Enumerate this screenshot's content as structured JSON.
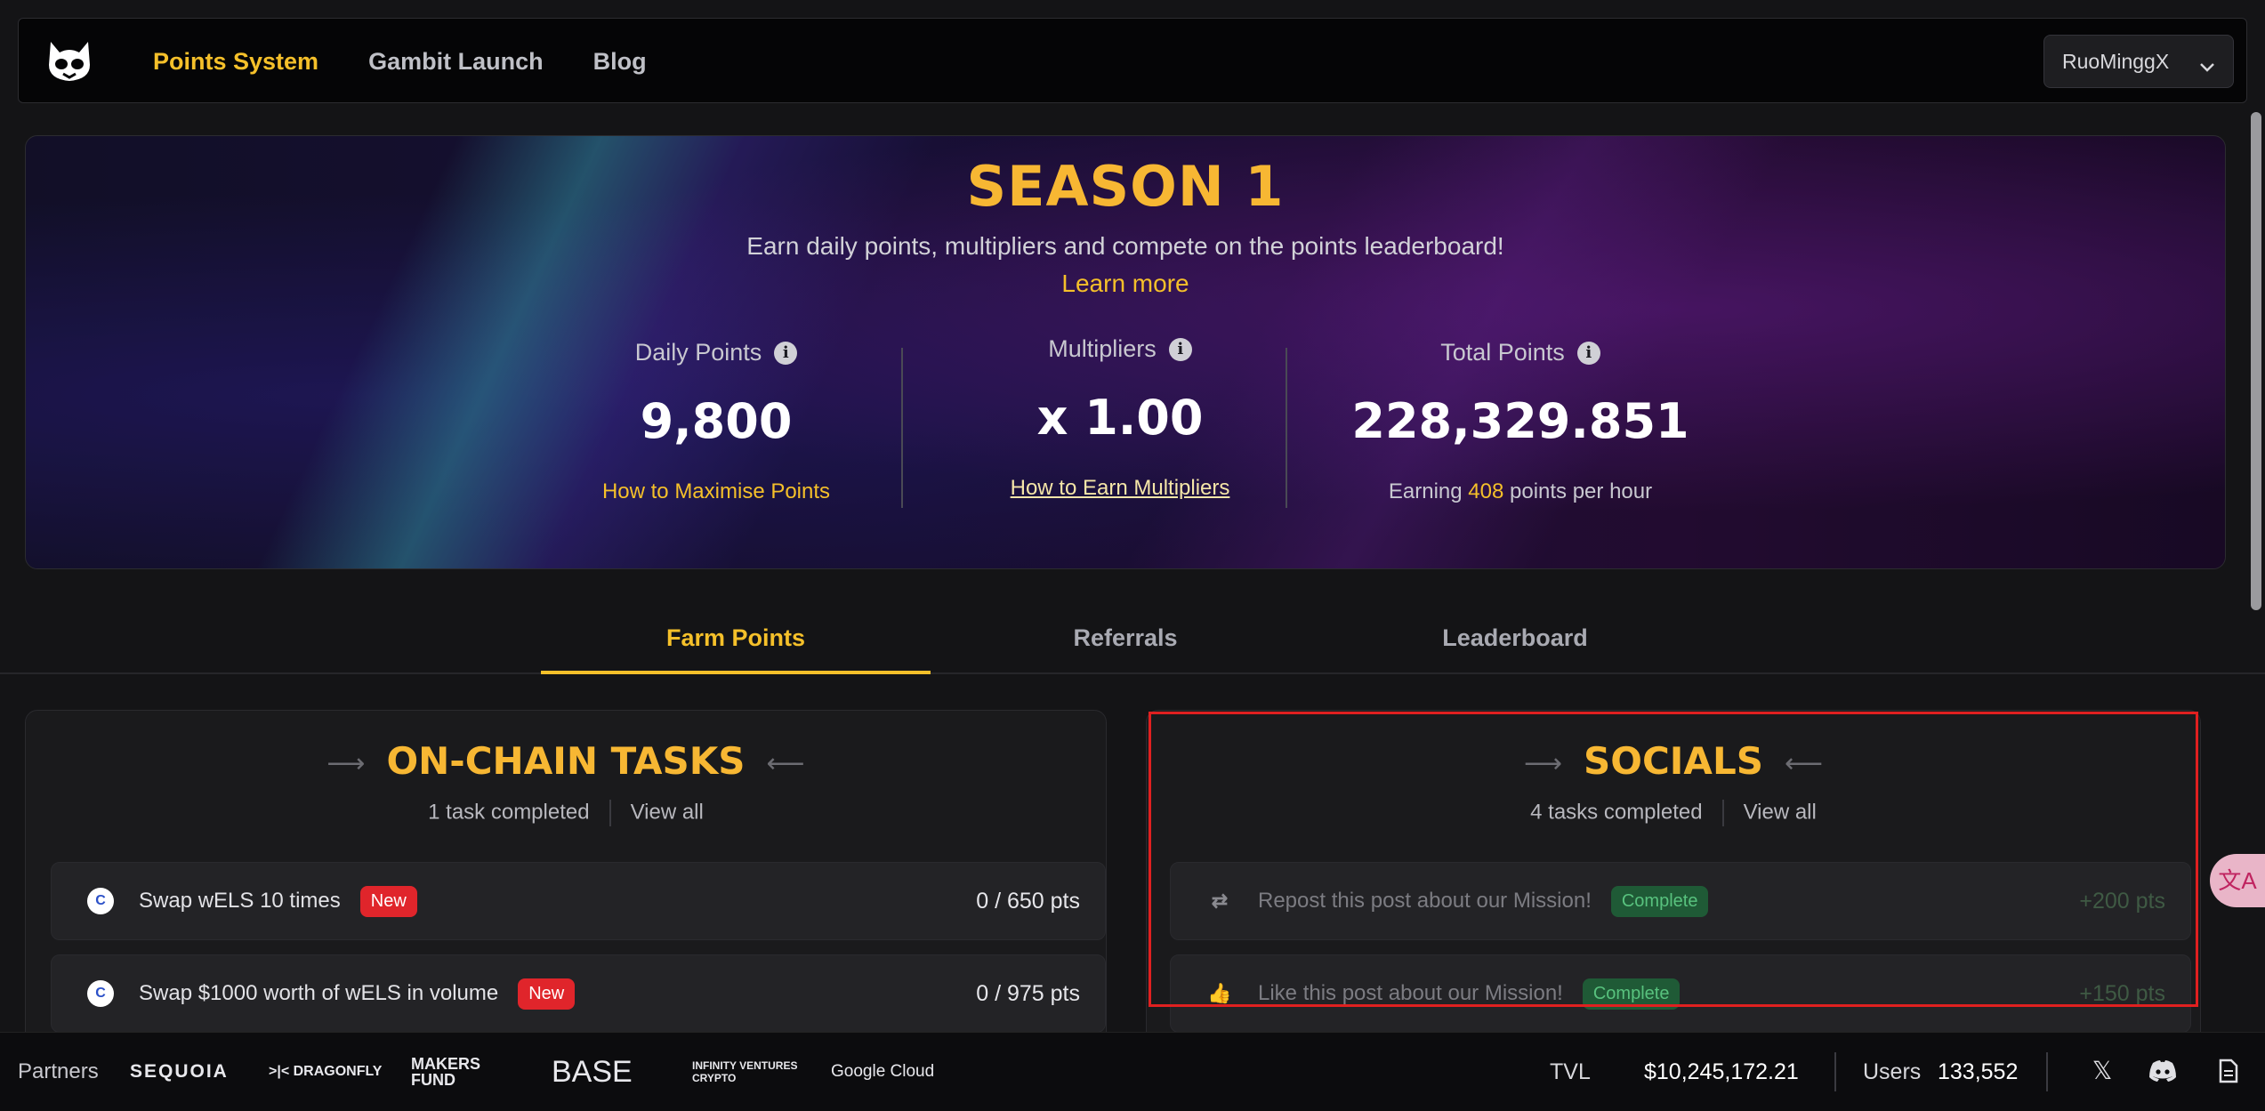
{
  "nav": {
    "links": [
      "Points System",
      "Gambit Launch",
      "Blog"
    ],
    "user": "RuoMinggX"
  },
  "hero": {
    "title": "SEASON 1",
    "subtitle": "Earn daily points, multipliers and compete on the points leaderboard!",
    "learn_more": "Learn more",
    "daily": {
      "label": "Daily Points",
      "value": "9,800",
      "link": "How to Maximise Points"
    },
    "multipliers": {
      "label": "Multipliers",
      "value": "x 1.00",
      "link": "How to Earn Multipliers"
    },
    "total": {
      "label": "Total Points",
      "value": "228,329.851",
      "earn_prefix": "Earning",
      "earn_value": "408",
      "earn_suffix": "points per hour"
    }
  },
  "tabs": [
    "Farm Points",
    "Referrals",
    "Leaderboard"
  ],
  "onchain": {
    "title": "ON-CHAIN TASKS",
    "completed": "1 task completed",
    "view_all": "View all",
    "tasks": [
      {
        "name": "Swap wELS 10 times",
        "badge": "New",
        "pts": "0 / 650 pts"
      },
      {
        "name": "Swap $1000 worth of wELS in volume",
        "badge": "New",
        "pts": "0 / 975 pts"
      }
    ]
  },
  "socials": {
    "title": "SOCIALS",
    "completed": "4 tasks completed",
    "view_all": "View all",
    "tasks": [
      {
        "name": "Repost this post about our Mission!",
        "badge": "Complete",
        "pts": "+200 pts",
        "icon": "repost-icon"
      },
      {
        "name": "Like this post about our Mission!",
        "badge": "Complete",
        "pts": "+150 pts",
        "icon": "thumbs-up-icon"
      }
    ]
  },
  "footer": {
    "partners_label": "Partners",
    "partners": [
      "SEQUOIA",
      ">|< DRAGONFLY",
      "MAKERS FUND",
      "BASE",
      "INFINITY VENTURES CRYPTO",
      "Google Cloud"
    ],
    "tvl_label": "TVL",
    "tvl_value": "$10,245,172.21",
    "users_label": "Users",
    "users_value": "133,552"
  },
  "colors": {
    "accent": "#f5c02a",
    "title": "#f7b733",
    "badge_new": "#e0252b",
    "badge_complete": "#1f5a36",
    "highlight": "#e02020"
  }
}
